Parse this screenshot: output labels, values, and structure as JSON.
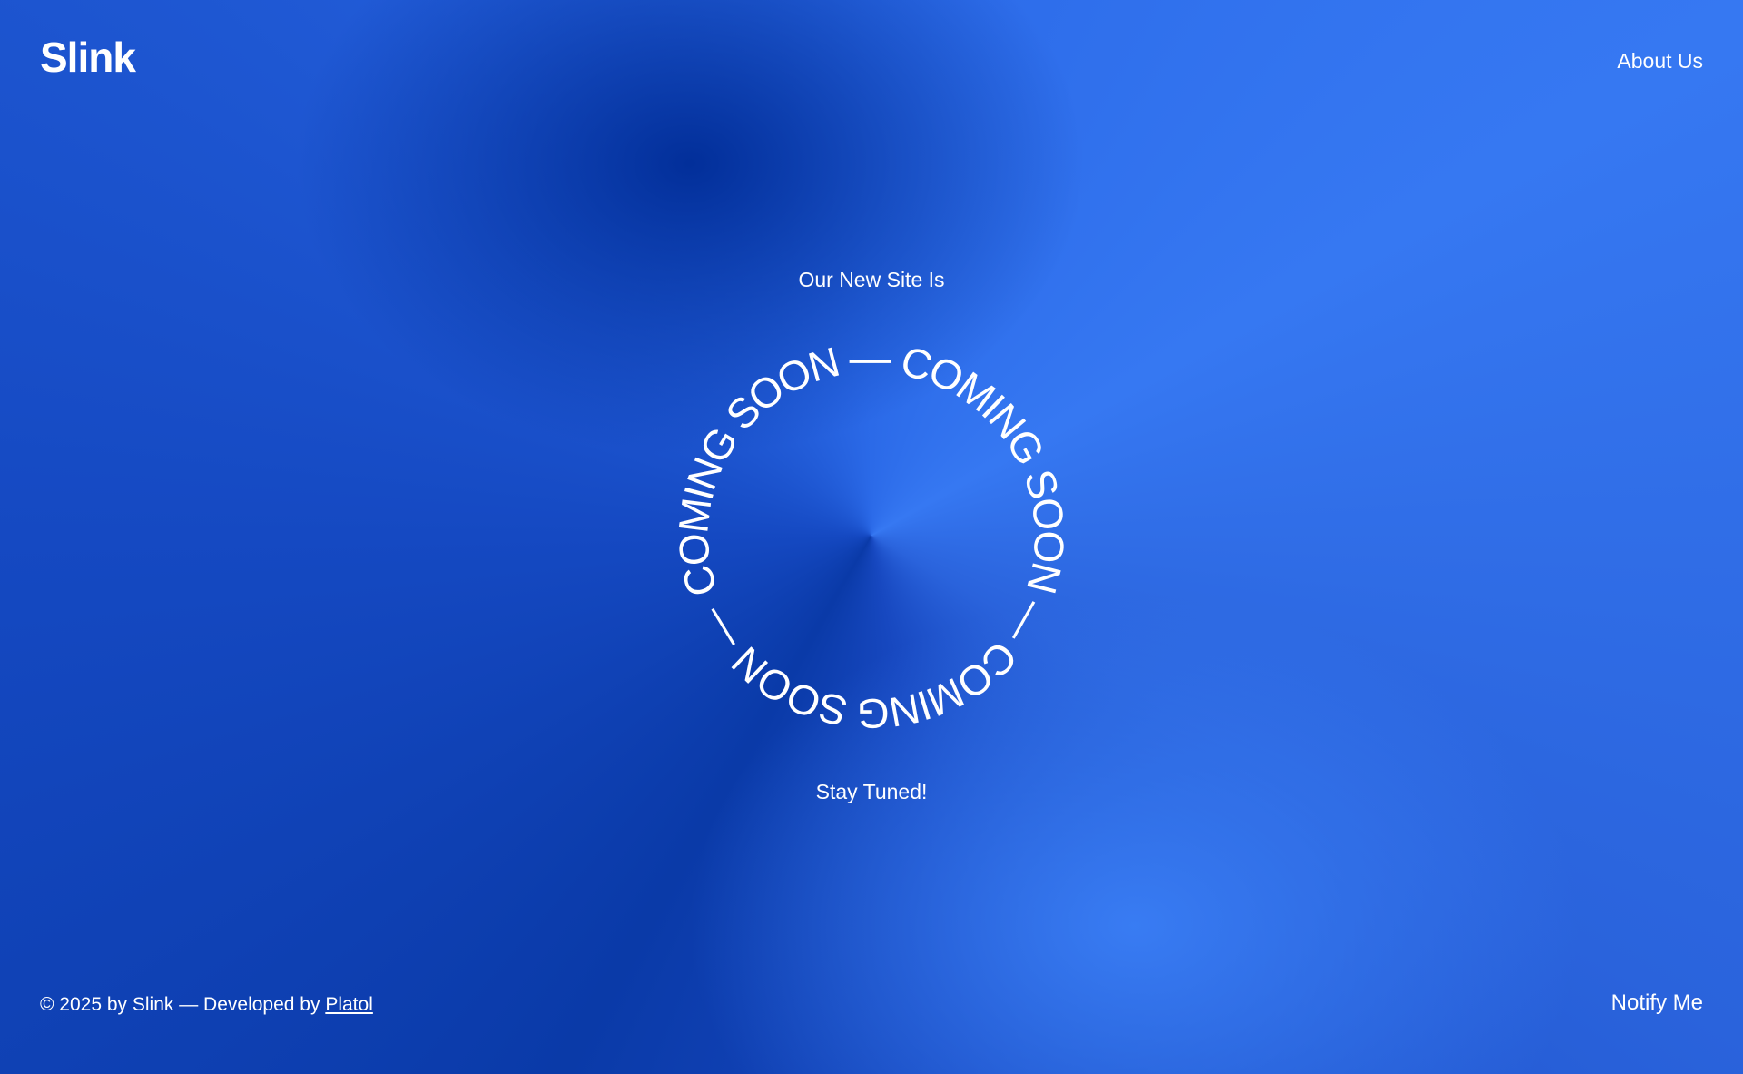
{
  "header": {
    "logo": "Slink",
    "nav_about": "About Us"
  },
  "hero": {
    "subheading": "Our New Site Is",
    "ring_text": "COMING SOON — COMING SOON — COMING SOON — ",
    "tagline": "Stay Tuned!"
  },
  "footer": {
    "copyright": "© 2025 by Slink — Developed by ",
    "developer_link": "Platol",
    "notify": "Notify Me"
  },
  "colors": {
    "text": "#ffffff",
    "background_dark": "#0a3aa8",
    "background_light": "#3678f2"
  }
}
